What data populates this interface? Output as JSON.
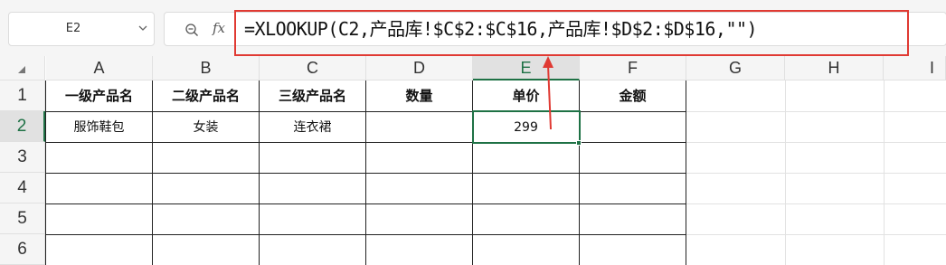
{
  "formula_bar": {
    "name_box": "E2",
    "fx_label": "fx",
    "formula": "=XLOOKUP(C2,产品库!$C$2:$C$16,产品库!$D$2:$D$16,\"\")"
  },
  "sheet": {
    "columns": [
      "A",
      "B",
      "C",
      "D",
      "E",
      "F",
      "G",
      "H",
      "I"
    ],
    "active_column": "E",
    "rows": [
      "1",
      "2",
      "3",
      "4",
      "5",
      "6"
    ],
    "active_row": "2",
    "headers": {
      "a": "一级产品名",
      "b": "二级产品名",
      "c": "三级产品名",
      "d": "数量",
      "e": "单价",
      "f": "金额"
    },
    "row2": {
      "a": "服饰鞋包",
      "b": "女装",
      "c": "连衣裙",
      "d": "",
      "e": "299",
      "f": ""
    }
  },
  "colors": {
    "selection": "#1e7145",
    "annotation": "#e03a33"
  }
}
